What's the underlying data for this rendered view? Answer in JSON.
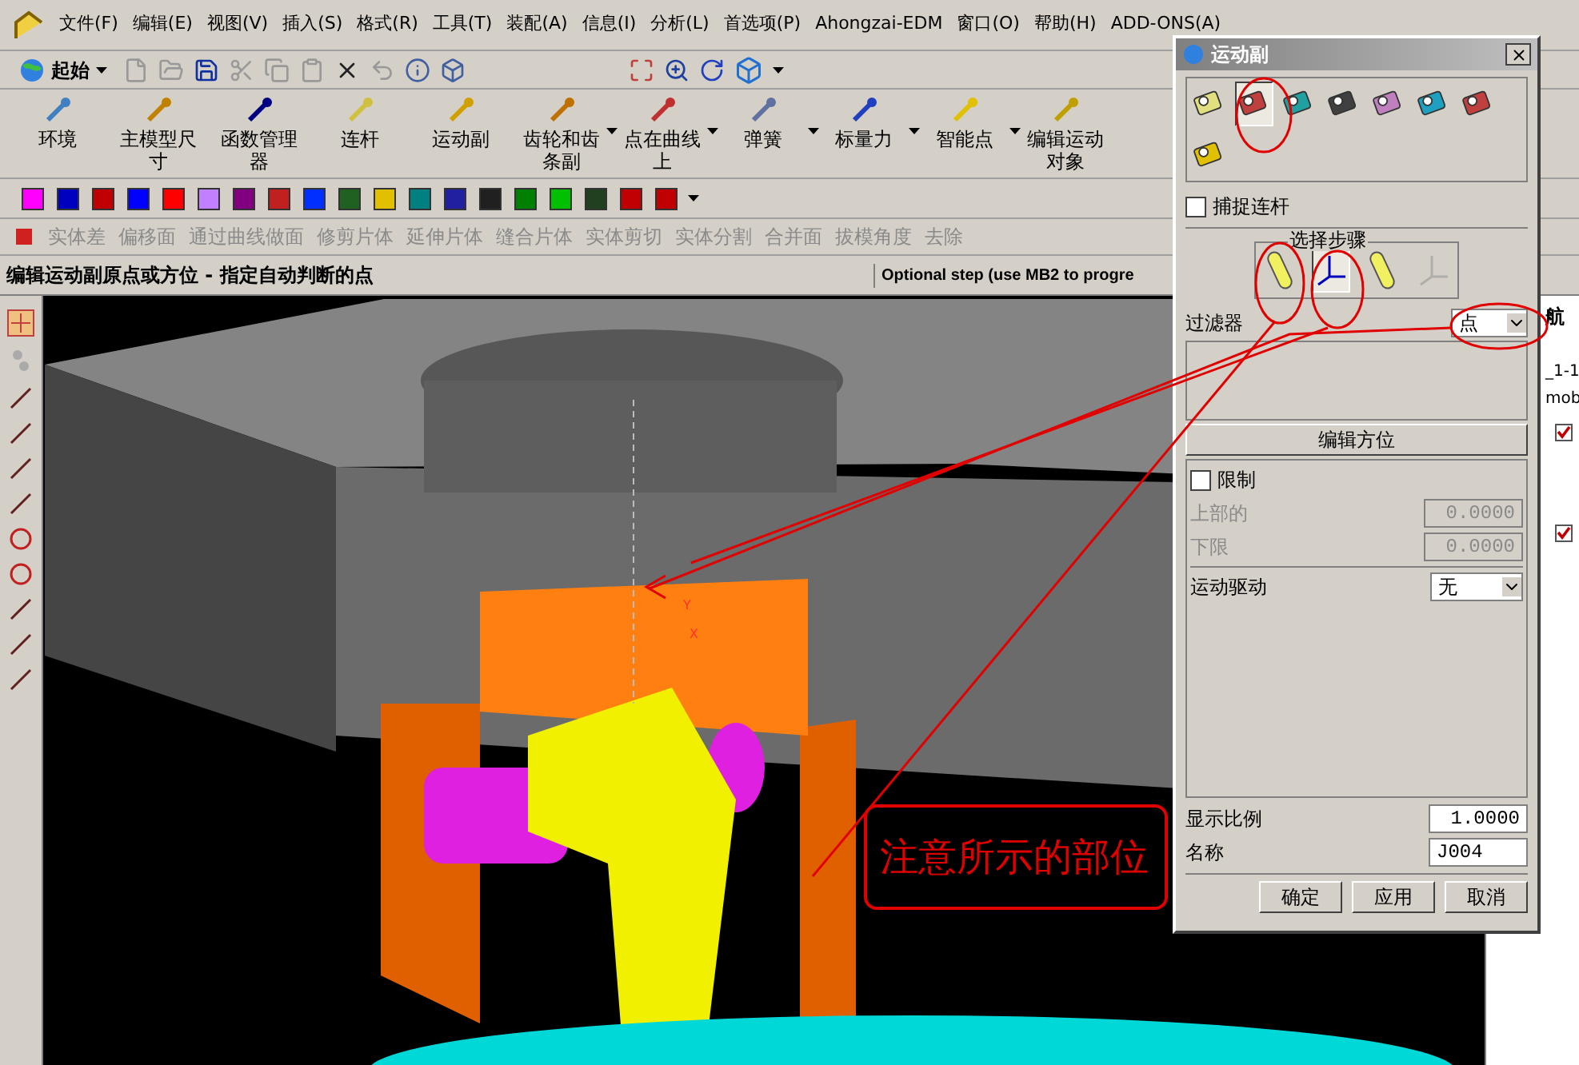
{
  "menu": [
    "文件(F)",
    "编辑(E)",
    "视图(V)",
    "插入(S)",
    "格式(R)",
    "工具(T)",
    "装配(A)",
    "信息(I)",
    "分析(L)",
    "首选项(P)",
    "Ahongzai-EDM",
    "窗口(O)",
    "帮助(H)",
    "ADD-ONS(A)"
  ],
  "start_button": "起始",
  "motion_toolbar": [
    {
      "label": "环境",
      "dropdown": false
    },
    {
      "label": "主模型尺寸",
      "dropdown": false
    },
    {
      "label": "函数管理器",
      "dropdown": false
    },
    {
      "label": "连杆",
      "dropdown": false
    },
    {
      "label": "运动副",
      "dropdown": false
    },
    {
      "label": "齿轮和齿条副",
      "dropdown": true
    },
    {
      "label": "点在曲线上",
      "dropdown": true
    },
    {
      "label": "弹簧",
      "dropdown": true
    },
    {
      "label": "标量力",
      "dropdown": true
    },
    {
      "label": "智能点",
      "dropdown": true
    },
    {
      "label": "编辑运动对象",
      "dropdown": false
    }
  ],
  "feature_toolbar": [
    {
      "label": "实体差",
      "disabled": true
    },
    {
      "label": "偏移面",
      "disabled": true
    },
    {
      "label": "通过曲线做面",
      "disabled": true
    },
    {
      "label": "修剪片体",
      "disabled": true
    },
    {
      "label": "延伸片体",
      "disabled": true
    },
    {
      "label": "缝合片体",
      "disabled": true
    },
    {
      "label": "实体剪切",
      "disabled": true
    },
    {
      "label": "实体分割",
      "disabled": true
    },
    {
      "label": "合并面",
      "disabled": true
    },
    {
      "label": "拔模角度",
      "disabled": true
    },
    {
      "label": "去除",
      "disabled": true
    }
  ],
  "cue_line": "编辑运动副原点或方位 - 指定自动判断的点",
  "status_line": "Optional step (use MB2 to progre",
  "triad_labels": [
    "Y",
    "X"
  ],
  "navigator": {
    "title": "航",
    "items": [
      {
        "label": "_1-1"
      },
      {
        "label": "mob"
      }
    ],
    "checks": [
      {
        "checked": true
      },
      {
        "checked": true
      }
    ]
  },
  "annotation": "注意所示的部位",
  "dialog": {
    "title": "运动副",
    "type_icons": [
      {
        "selected": false
      },
      {
        "selected": true
      },
      {
        "selected": false
      },
      {
        "selected": false
      },
      {
        "selected": false
      },
      {
        "selected": false
      },
      {
        "selected": false
      },
      {
        "selected": false
      }
    ],
    "snap_link": {
      "label": "捕捉连杆",
      "checked": false
    },
    "steps": {
      "title": "选择步骤",
      "items": [
        {
          "selected": false,
          "disabled": false
        },
        {
          "selected": true,
          "disabled": false
        },
        {
          "selected": false,
          "disabled": false
        },
        {
          "selected": false,
          "disabled": true
        }
      ]
    },
    "filter": {
      "label": "过滤器",
      "value": "点"
    },
    "edit_orientation": "编辑方位",
    "limits": {
      "label": "限制",
      "checked": false
    },
    "fields": [
      {
        "label": "上部的",
        "value": "0.0000",
        "disabled": true
      },
      {
        "label": "下限",
        "value": "0.0000",
        "disabled": true
      }
    ],
    "driver": {
      "label": "运动驱动",
      "value": "无"
    },
    "scale": {
      "label": "显示比例",
      "value": "1.0000"
    },
    "name": {
      "label": "名称",
      "value": "J004"
    },
    "buttons": [
      "确定",
      "应用",
      "取消"
    ]
  }
}
